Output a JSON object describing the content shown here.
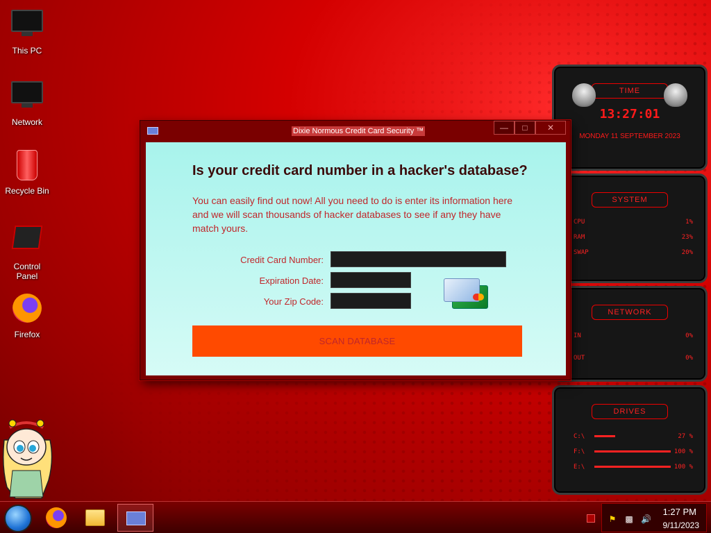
{
  "desktop": {
    "icons": [
      {
        "label": "This PC"
      },
      {
        "label": "Network"
      },
      {
        "label": "Recycle Bin"
      },
      {
        "label": "Control Panel"
      },
      {
        "label": "Firefox"
      }
    ]
  },
  "window": {
    "title": "Dixie Normous Credit Card Security ™",
    "buttons": {
      "minimize": "—",
      "maximize": "□",
      "close": "✕"
    },
    "heading": "Is your credit card number in a hacker's database?",
    "intro": "You can easily find out now! All you need to do is enter its information here and we will scan thousands of hacker databases to see if any they have match yours.",
    "form": {
      "card_number_label": "Credit Card Number:",
      "card_number_value": "",
      "expiration_label": "Expiration Date:",
      "expiration_value": "",
      "zip_label": "Your Zip Code:",
      "zip_value": ""
    },
    "scan_button": "SCAN DATABASE"
  },
  "gadgets": {
    "time": {
      "title": "TIME",
      "clock": "13:27:01",
      "date": "MONDAY 11 SEPTEMBER 2023"
    },
    "system": {
      "title": "SYSTEM",
      "rows": [
        {
          "key": "CPU",
          "value": "1%",
          "level": 0.01
        },
        {
          "key": "RAM",
          "value": "23%",
          "level": 0.23
        },
        {
          "key": "SWAP",
          "value": "20%",
          "level": 0.2
        }
      ]
    },
    "network": {
      "title": "NETWORK",
      "rows": [
        {
          "key": "IN",
          "value": "0%"
        },
        {
          "key": "OUT",
          "value": "0%"
        }
      ]
    },
    "drives": {
      "title": "DRIVES",
      "rows": [
        {
          "key": "C:\\",
          "value": "27 %",
          "level": 0.27
        },
        {
          "key": "F:\\",
          "value": "100 %",
          "level": 1.0
        },
        {
          "key": "E:\\",
          "value": "100 %",
          "level": 1.0
        }
      ]
    }
  },
  "taskbar": {
    "apps": [
      "start-orb",
      "firefox",
      "file-explorer",
      "credit-card-security"
    ],
    "clock_time": "1:27 PM",
    "clock_date": "9/11/2023"
  },
  "colors": {
    "accent_red": "#ff2222",
    "desktop_red": "#d40000",
    "dialog_bg": "#a8f3ec",
    "scan_button": "#ff4a00",
    "text_red": "#c0262a"
  }
}
